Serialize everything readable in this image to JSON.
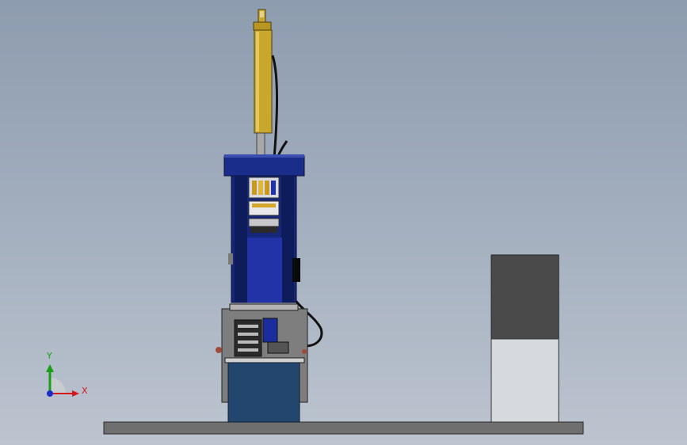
{
  "viewport": {
    "background_top": "#8e9caf",
    "background_bottom": "#bcc4cf"
  },
  "model": {
    "parts": [
      "base-plate",
      "machine-frame",
      "hydraulic-cylinder",
      "control-panel",
      "hydraulic-tank",
      "side-cabinet"
    ],
    "colors": {
      "cylinder": "#c9a72c",
      "frame": "#16277a",
      "tank": "#23466e",
      "cabinet_top": "#4a4a4a",
      "cabinet_bottom": "#d6d9de",
      "base_plate": "#6f6f6f"
    }
  },
  "triad": {
    "x_label": "X",
    "y_label": "Y",
    "x_color": "#d21a1a",
    "y_color": "#1a9e1a",
    "z_color": "#1a2ec8"
  }
}
